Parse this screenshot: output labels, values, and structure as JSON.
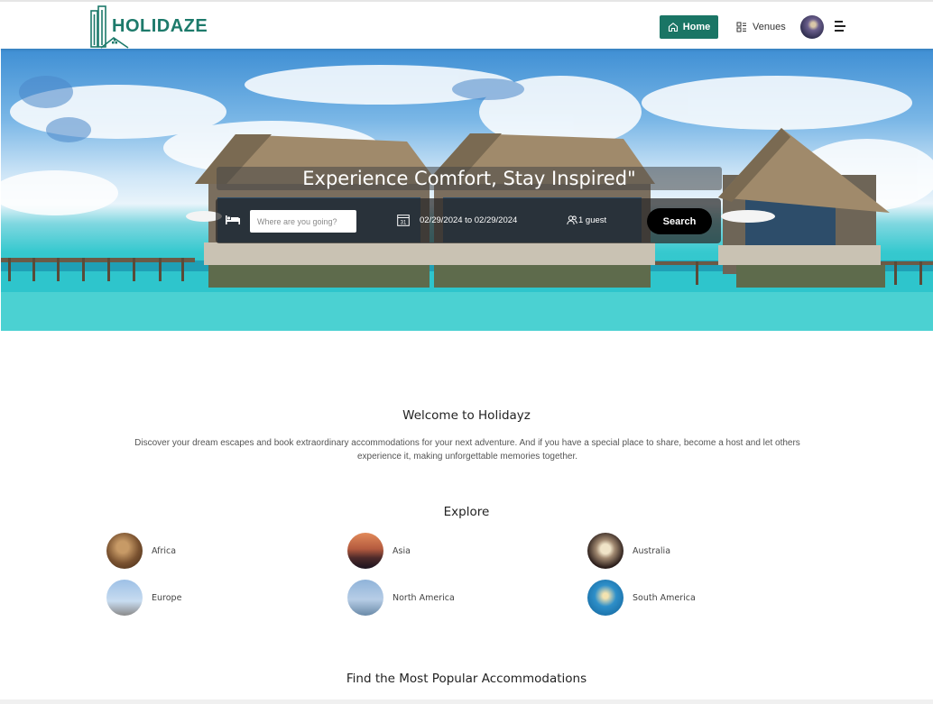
{
  "header": {
    "logo_text": "HOLIDAZE",
    "nav": {
      "home_label": "Home",
      "venues_label": "Venues"
    },
    "accent_color": "#1a7565"
  },
  "hero": {
    "title": "Experience Comfort, Stay Inspired\"",
    "search": {
      "destination_placeholder": "Where are you going?",
      "dates_value": "02/29/2024 to 02/29/2024",
      "guests_value": "1 guest",
      "search_label": "Search",
      "calendar_day": "31"
    }
  },
  "welcome": {
    "title": "Welcome to Holidayz",
    "text": "Discover your dream escapes and book extraordinary accommodations for your next adventure. And if you have a special place to share, become a host and let others experience it, making unforgettable memories together."
  },
  "explore": {
    "title": "Explore",
    "regions": [
      {
        "label": "Africa"
      },
      {
        "label": "Asia"
      },
      {
        "label": "Australia"
      },
      {
        "label": "Europe"
      },
      {
        "label": "North America"
      },
      {
        "label": "South America"
      }
    ]
  },
  "popular": {
    "title": "Find the Most Popular Accommodations"
  }
}
